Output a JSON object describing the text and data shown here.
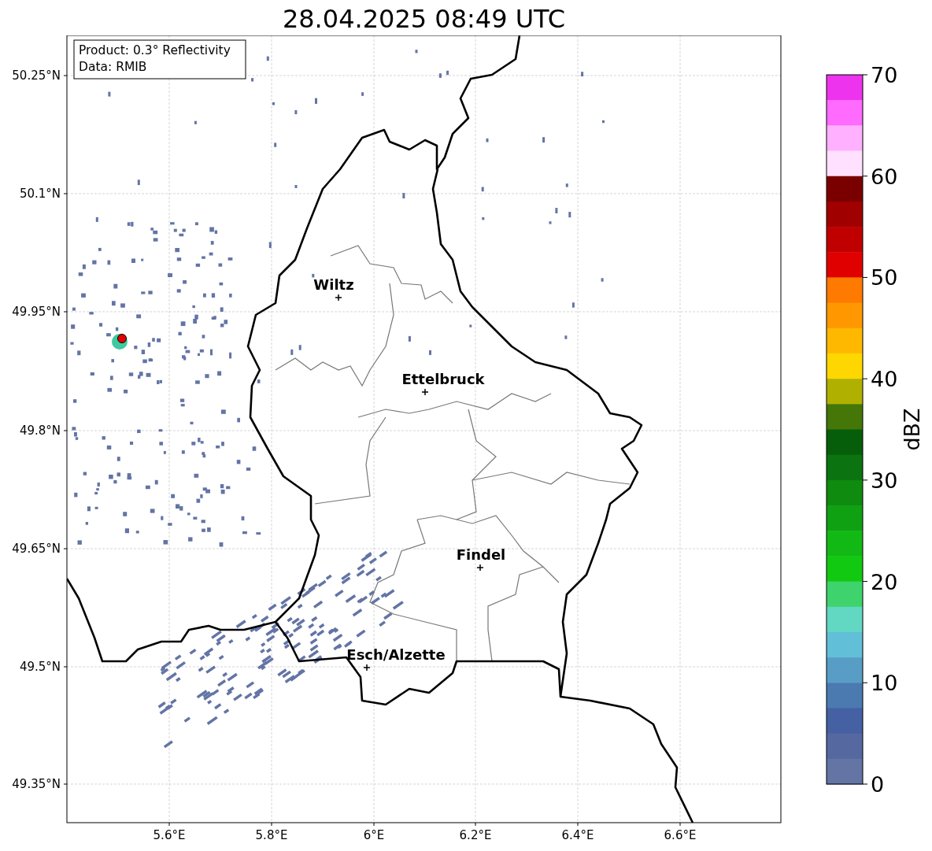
{
  "title": "28.04.2025 08:49 UTC",
  "info_box": [
    "Product: 0.3° Reflectivity",
    "Data: RMIB"
  ],
  "lat_labels": [
    "50.25°N",
    "50.1°N",
    "49.95°N",
    "49.8°N",
    "49.65°N",
    "49.5°N",
    "49.35°N"
  ],
  "lon_labels": [
    "5.6°E",
    "5.8°E",
    "6°E",
    "6.2°E",
    "6.4°E",
    "6.6°E"
  ],
  "cities": [
    {
      "name": "Wiltz"
    },
    {
      "name": "Ettelbruck"
    },
    {
      "name": "Findel"
    },
    {
      "name": "Esch/Alzette"
    }
  ],
  "colorbar": {
    "label": "dBZ",
    "ticks": [
      "70",
      "60",
      "50",
      "40",
      "30",
      "20",
      "10",
      "0"
    ],
    "segments": [
      {
        "color": "#ee33ee"
      },
      {
        "color": "#ff6aff"
      },
      {
        "color": "#ffb0ff"
      },
      {
        "color": "#ffe0ff"
      },
      {
        "color": "#7a0000"
      },
      {
        "color": "#a00000"
      },
      {
        "color": "#c00000"
      },
      {
        "color": "#e00000"
      },
      {
        "color": "#ff7a00"
      },
      {
        "color": "#ff9800"
      },
      {
        "color": "#ffb800"
      },
      {
        "color": "#ffd700"
      },
      {
        "color": "#b0b000"
      },
      {
        "color": "#447608"
      },
      {
        "color": "#065e0b"
      },
      {
        "color": "#0b7410"
      },
      {
        "color": "#0f8b10"
      },
      {
        "color": "#10a112"
      },
      {
        "color": "#12b914"
      },
      {
        "color": "#12c912"
      },
      {
        "color": "#3ed36c"
      },
      {
        "color": "#62d8c2"
      },
      {
        "color": "#62bfd8"
      },
      {
        "color": "#589dc6"
      },
      {
        "color": "#4a7ab0"
      },
      {
        "color": "#4560a3"
      },
      {
        "color": "#5568a0"
      },
      {
        "color": "#6374a5"
      }
    ]
  }
}
